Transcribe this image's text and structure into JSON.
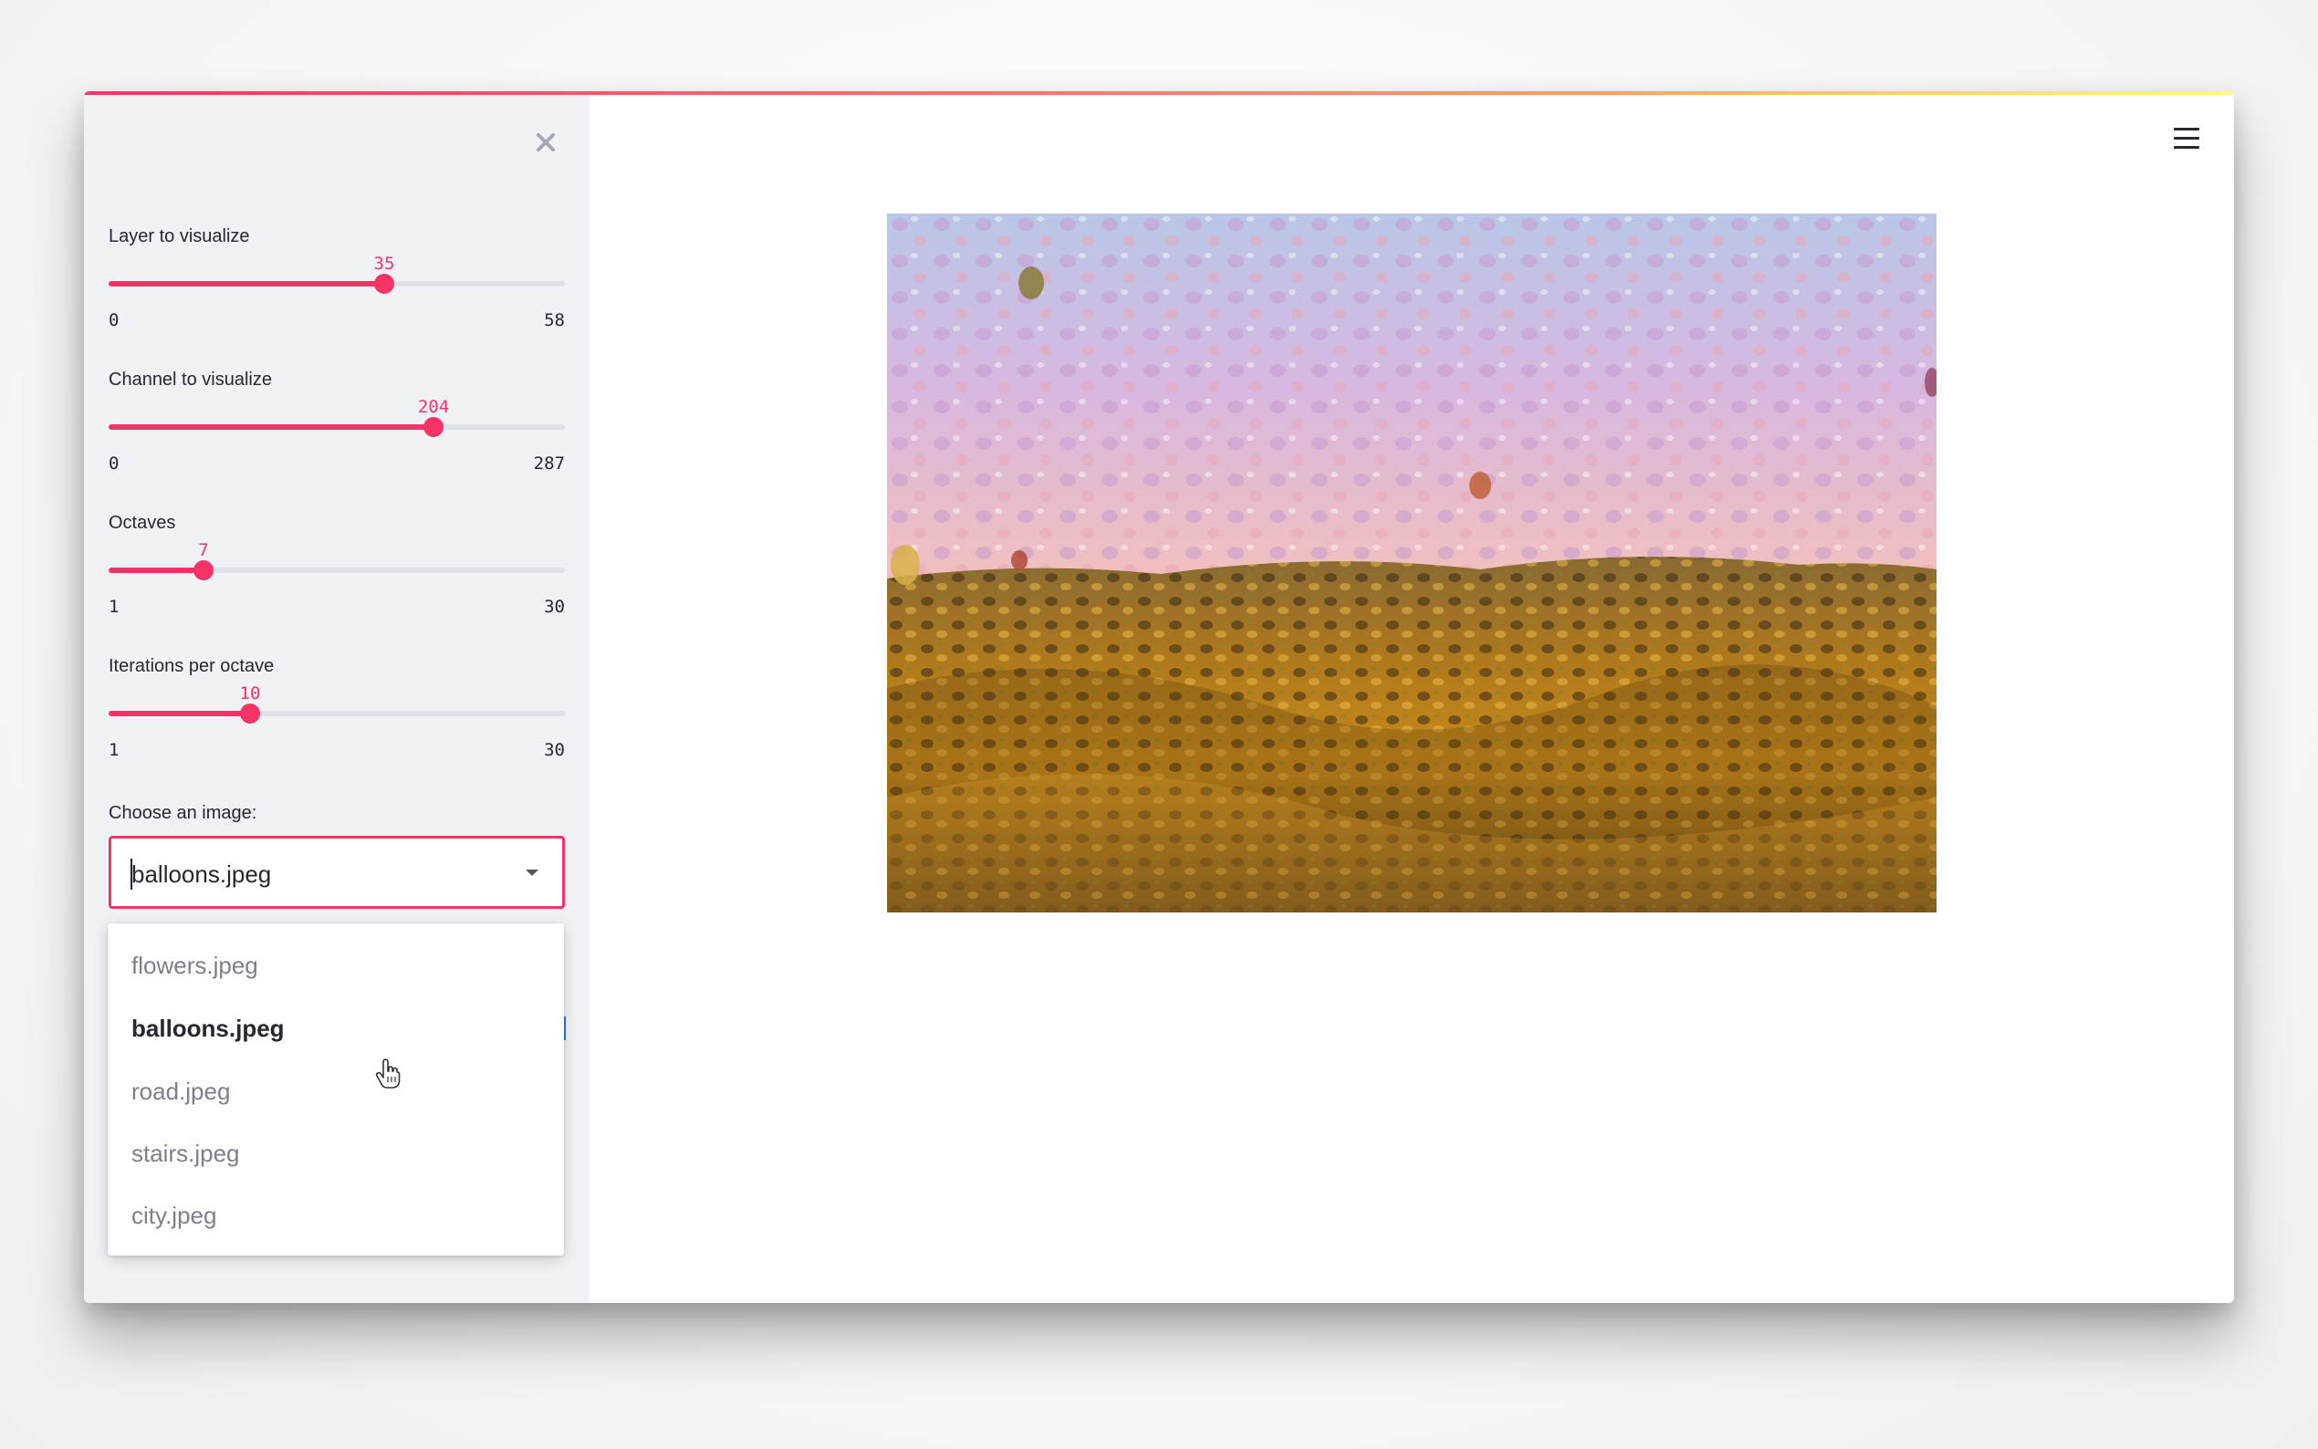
{
  "sidebar": {
    "close_icon": "close-icon",
    "sliders": [
      {
        "label": "Layer to visualize",
        "value": "35",
        "min": "0",
        "max": "58",
        "fraction": 0.603
      },
      {
        "label": "Channel to visualize",
        "value": "204",
        "min": "0",
        "max": "287",
        "fraction": 0.711
      },
      {
        "label": "Octaves",
        "value": "7",
        "min": "1",
        "max": "30",
        "fraction": 0.207
      },
      {
        "label": "Iterations per octave",
        "value": "10",
        "min": "1",
        "max": "30",
        "fraction": 0.31
      }
    ],
    "select": {
      "label": "Choose an image:",
      "value": "balloons.jpeg",
      "options": [
        "flowers.jpeg",
        "balloons.jpeg",
        "road.jpeg",
        "stairs.jpeg",
        "city.jpeg"
      ],
      "selected_index": 1
    }
  },
  "main": {
    "menu_icon": "hamburger-menu-icon",
    "image_alt": "deep dream balloons landscape"
  },
  "colors": {
    "accent": "#f63366",
    "sidebar_bg": "#f0f2f6",
    "text": "#262730"
  }
}
